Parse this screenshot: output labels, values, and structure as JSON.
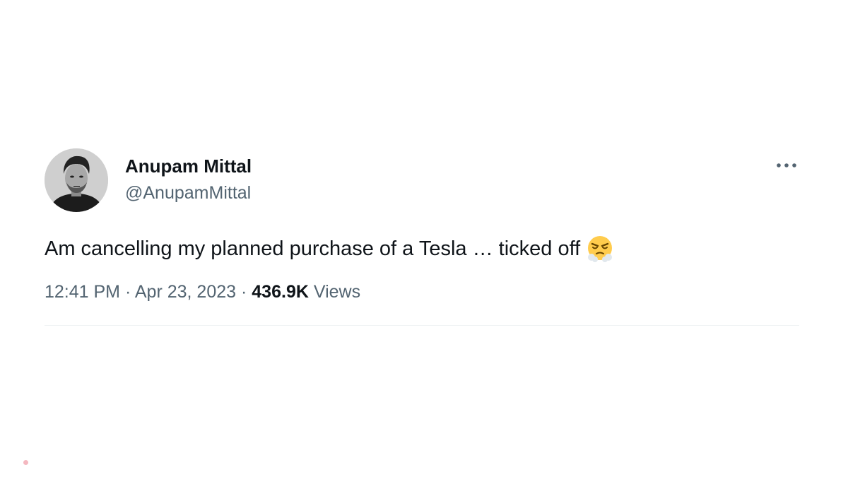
{
  "author": {
    "display_name": "Anupam Mittal",
    "handle": "@AnupamMittal"
  },
  "more_icon": "more-horizontal-icon",
  "tweet": {
    "text": "Am cancelling my planned purchase of a Tesla … ticked off",
    "emoji": "face-with-steam-from-nose"
  },
  "meta": {
    "time": "12:41 PM",
    "separator": "·",
    "date": "Apr 23, 2023",
    "views_count": "436.9K",
    "views_label": "Views"
  },
  "colors": {
    "text_primary": "#0f1419",
    "text_secondary": "#536471",
    "divider": "#eff3f4"
  }
}
